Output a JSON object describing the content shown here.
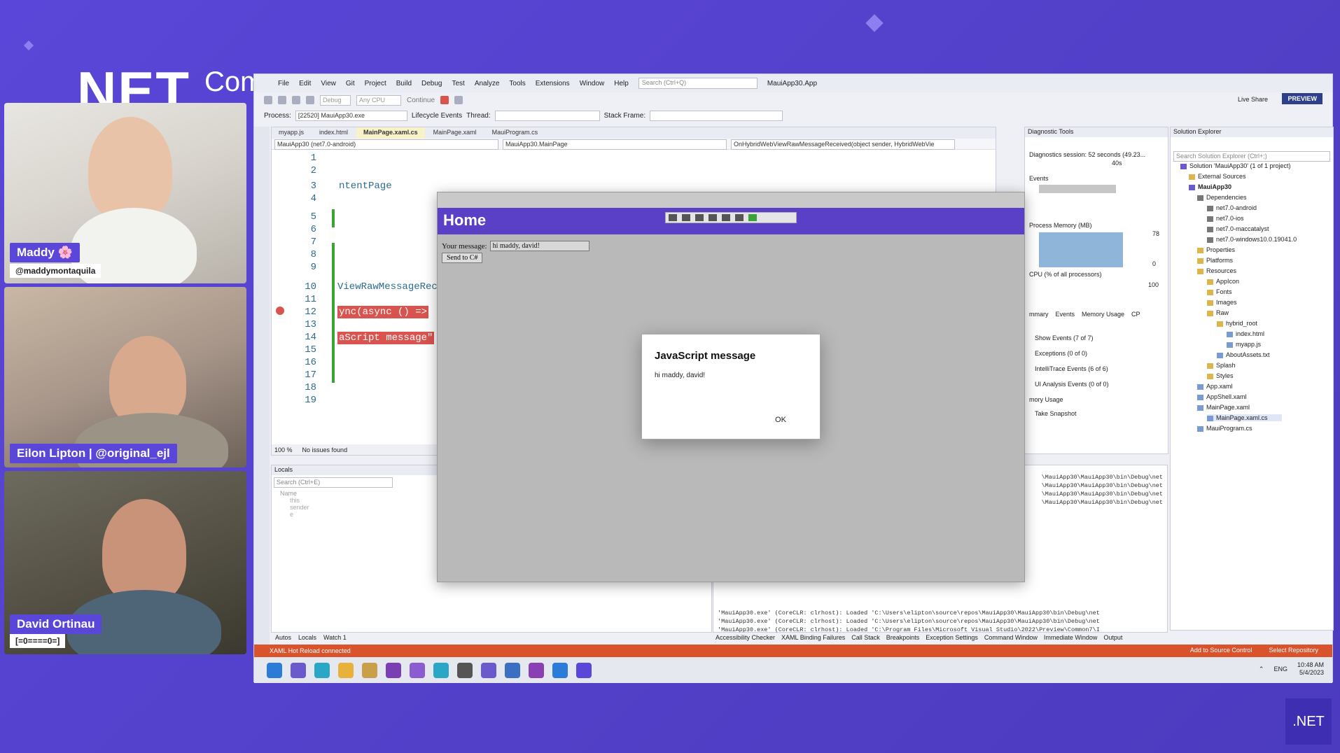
{
  "branding": {
    "title": "NET",
    "subtitle": "Com",
    "logo": ".NET"
  },
  "cams": [
    {
      "name": "Maddy 🌸",
      "handle": "@maddymontaquila"
    },
    {
      "name": "Eilon Lipton | @original_ejl"
    },
    {
      "name": "David Ortinau",
      "handle": "[=0====0=]"
    }
  ],
  "menu": [
    "File",
    "Edit",
    "View",
    "Git",
    "Project",
    "Build",
    "Debug",
    "Test",
    "Analyze",
    "Tools",
    "Extensions",
    "Window",
    "Help"
  ],
  "search": {
    "placeholder": "Search (Ctrl+Q)"
  },
  "window_title": "MauiApp30.App",
  "toolbar": {
    "config": "Debug",
    "platform": "Any CPU",
    "continue": "Continue",
    "live_share": "Live Share",
    "preview": "PREVIEW"
  },
  "toolbar2": {
    "process_label": "Process:",
    "process": "[22520] MauiApp30.exe",
    "lifecycle": "Lifecycle Events",
    "thread_label": "Thread:",
    "stack_label": "Stack Frame:"
  },
  "editor": {
    "tabs": [
      "myapp.js",
      "index.html",
      "MainPage.xaml.cs",
      "MainPage.xaml",
      "MauiProgram.cs"
    ],
    "active_tab": "MainPage.xaml.cs",
    "nav": [
      "MauiApp30 (net7.0-android)",
      "MauiApp30.MainPage",
      "OnHybridWebViewRawMessageReceived(object sender, HybridWebVie"
    ],
    "line_numbers": [
      "1",
      "2",
      "3",
      "4",
      "5",
      "6",
      "7",
      "8",
      "9",
      "10",
      "11",
      "12",
      "13",
      "14",
      "15",
      "16",
      "17",
      "18",
      "19"
    ],
    "code": {
      "l3": "ntentPage",
      "l10": "ViewRawMessageRece",
      "l12": "ync(async () =>",
      "l14": "aScript message\""
    },
    "zoom": "100 %",
    "issues": "No issues found"
  },
  "locals": {
    "title": "Locals",
    "search_placeholder": "Search (Ctrl+E)",
    "col_name": "Name",
    "rows": [
      "this",
      "sender",
      "e"
    ]
  },
  "bottom_tabs_left": [
    "Autos",
    "Locals",
    "Watch 1"
  ],
  "bottom_tabs_right": [
    "Accessibility Checker",
    "XAML Binding Failures",
    "Call Stack",
    "Breakpoints",
    "Exception Settings",
    "Command Window",
    "Immediate Window",
    "Output"
  ],
  "output_lines": [
    "\\MauiApp30\\MauiApp30\\bin\\Debug\\net",
    "\\MauiApp30\\MauiApp30\\bin\\Debug\\net",
    "\\MauiApp30\\MauiApp30\\bin\\Debug\\net",
    "\\MauiApp30\\MauiApp30\\bin\\Debug\\net",
    "'MauiApp30.exe' (CoreCLR: clrhost): Loaded 'C:\\Users\\elipton\\source\\repos\\MauiApp30\\MauiApp30\\bin\\Debug\\net",
    "'MauiApp30.exe' (CoreCLR: clrhost): Loaded 'C:\\Users\\elipton\\source\\repos\\MauiApp30\\MauiApp30\\bin\\Debug\\net",
    "'MauiApp30.exe' (CoreCLR: clrhost): Loaded 'C:\\Program Files\\Microsoft Visual Studio\\2022\\Preview\\Common7\\I"
  ],
  "diagnostics": {
    "title": "Diagnostic Tools",
    "session": "Diagnostics session: 52 seconds (49.23...",
    "seconds": "40s",
    "events": "Events",
    "memory": "Process Memory (MB)",
    "mem_max": "78",
    "mem_min": "0",
    "cpu": "CPU (% of all processors)",
    "cpu_max": "100",
    "tabs": [
      "mmary",
      "Events",
      "Memory Usage",
      "CP"
    ],
    "items": [
      "Show Events (7 of 7)",
      "Exceptions (0 of 0)",
      "IntelliTrace Events (6 of 6)",
      "UI Analysis Events (0 of 0)"
    ],
    "mem_usage": "mory Usage",
    "snapshot": "Take Snapshot"
  },
  "solution": {
    "title": "Solution Explorer",
    "search_placeholder": "Search Solution Explorer (Ctrl+;)",
    "items": [
      "Solution 'MauiApp30' (1 of 1 project)",
      "External Sources",
      "MauiApp30",
      "Dependencies",
      "net7.0-android",
      "net7.0-ios",
      "net7.0-maccatalyst",
      "net7.0-windows10.0.19041.0",
      "Properties",
      "Platforms",
      "Resources",
      "AppIcon",
      "Fonts",
      "Images",
      "Raw",
      "hybrid_root",
      "index.html",
      "myapp.js",
      "AboutAssets.txt",
      "Splash",
      "Styles",
      "App.xaml",
      "AppShell.xaml",
      "MainPage.xaml",
      "MainPage.xaml.cs",
      "MauiProgram.cs"
    ]
  },
  "status": {
    "left": "XAML Hot Reload connected",
    "source_control": "Add to Source Control",
    "repo": "Select Repository"
  },
  "tray": {
    "lang": "ENG",
    "time": "10:48 AM",
    "date": "5/4/2023"
  },
  "app": {
    "title": "Home",
    "label": "Your message:",
    "input_value": "hi maddy, david!",
    "button": "Send to C#"
  },
  "dialog": {
    "title": "JavaScript message",
    "message": "hi maddy, david!",
    "ok": "OK"
  },
  "colors": {
    "accent": "#5a46d8",
    "status_bar": "#d9532c",
    "breakpoint": "#d9534f"
  }
}
